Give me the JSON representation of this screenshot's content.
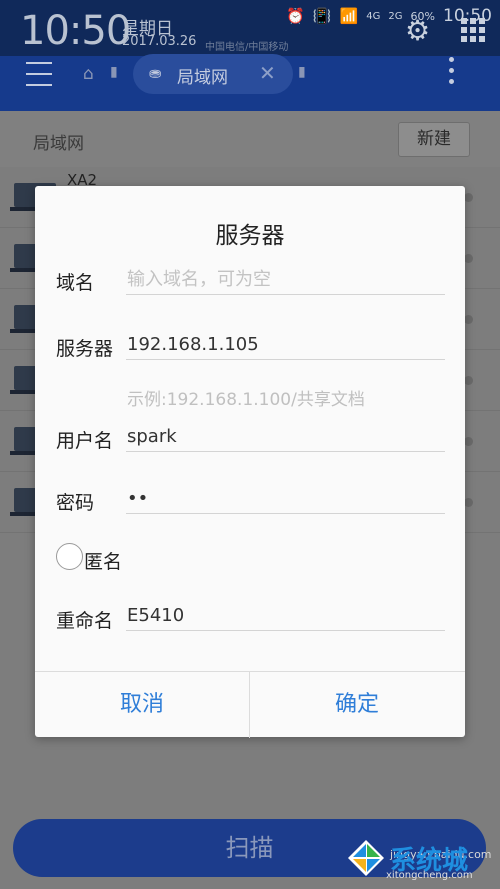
{
  "status_bar": {
    "clock": "10:50",
    "weekday": "星期日",
    "date": "2017.03.26",
    "carrier": "中国电信/中国移动",
    "network": "4G",
    "network2": "2G",
    "battery": "60%",
    "time_right": "10:50"
  },
  "app_bar": {
    "tab_label": "局域网"
  },
  "toolbar": {
    "breadcrumb": "局域网",
    "new_button": "新建"
  },
  "list": {
    "first_item_label": "XA2"
  },
  "dialog": {
    "title": "服务器",
    "domain_label": "域名",
    "domain_value": "",
    "domain_placeholder": "输入域名，可为空",
    "server_label": "服务器",
    "server_value": "192.168.1.105",
    "server_hint": "示例:192.168.1.100/共享文档",
    "username_label": "用户名",
    "username_value": "spark",
    "password_label": "密码",
    "password_value": "••",
    "anonymous_label": "匿名",
    "anonymous_checked": false,
    "rename_label": "重命名",
    "rename_value": "E5410",
    "cancel_button": "取消",
    "confirm_button": "确定"
  },
  "scan_button": "扫描",
  "watermark": {
    "brand": "系统城",
    "url": "xitongcheng.com",
    "url2": "jingyan.baidu.com"
  },
  "colors": {
    "status_bar_bg": "#10295a",
    "app_bar_bg": "#163a8c",
    "accent": "#2f7ed8",
    "dialog_bg": "#fafafa",
    "scan_button_bg": "#1c3c8c"
  }
}
